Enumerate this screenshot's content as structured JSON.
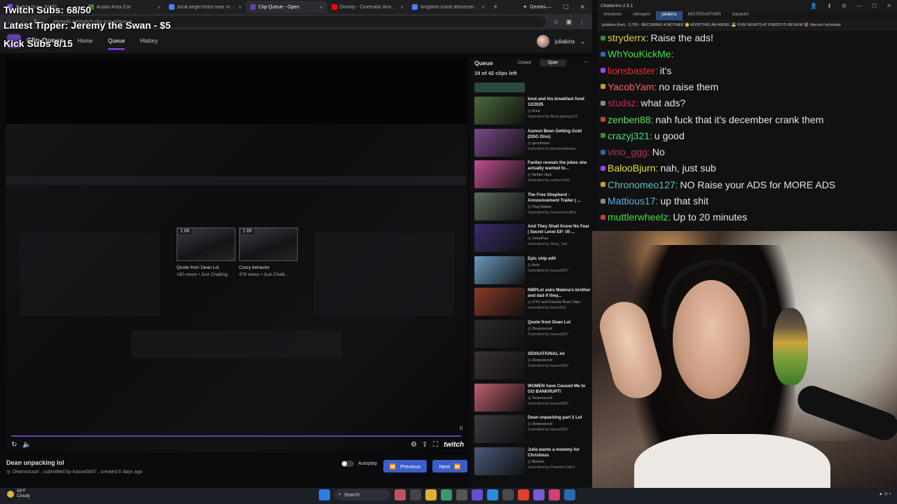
{
  "browser": {
    "tabs": [
      {
        "title": "Twitch Subs: 68/50",
        "color": "#9147ff"
      },
      {
        "title": "Austin Area Cor",
        "color": "#4a7a3a"
      },
      {
        "title": "local angel trees near me - Go",
        "color": "#4285f4"
      },
      {
        "title": "Clip Queue - Open",
        "color": "#6441a5",
        "active": true
      },
      {
        "title": "Divinity - Cinematic Announ",
        "color": "#ff0000"
      },
      {
        "title": "kingdom come deliverance",
        "color": "#4285f4"
      }
    ],
    "gemini_label": "Gemini",
    "url": "jakemiki.me/twitch-clip-queue/queue"
  },
  "site": {
    "title": "Clip Queue",
    "nav": [
      "Home",
      "Queue",
      "History"
    ],
    "active_nav": "Queue",
    "username": "juliakins"
  },
  "player": {
    "count": "0",
    "clips": [
      {
        "duration": "1:00",
        "title": "Quote from Dean Lol",
        "meta": "180 views • Just Chatting"
      },
      {
        "duration": "1:00",
        "title": "Crazy behavior",
        "meta": "478 views • Just Chatti..."
      }
    ]
  },
  "current": {
    "title": "Dean unpacking lol",
    "channel": "Deansocool",
    "submitted": ", submitted by kasun0007 , created 6 days ago",
    "autoplay_label": "Autoplay",
    "prev_label": "Previous",
    "next_label": "Next"
  },
  "queue": {
    "title": "Queue",
    "tabs": [
      "Closed",
      "Open"
    ],
    "active_tab": "Open",
    "count_text": "19 of 42 clips left",
    "items": [
      {
        "title": "knut and his breakfast food 12/2025",
        "source": "Knut",
        "by": "Submitted by BlueLightingZZZ",
        "color": "#4a6a3a"
      },
      {
        "title": "Asmon Been Getting Gold (DDG Diss)",
        "source": "guccimarx",
        "by": "Submitted by blackbirdsleeps",
        "color": "#7a4a8a"
      },
      {
        "title": "Fanfan reveals the jokes she actually wanted to...",
        "source": "fanfan clips",
        "by": "Submitted by nathan14x0",
        "color": "#c05090"
      },
      {
        "title": "The Free Shepherd - Announcement Trailer | ...",
        "source": "PlayStation",
        "by": "Submitted by GlazinDonutBoi",
        "color": "#5a6a5a"
      },
      {
        "title": "And They Shall Know No Fear | Secret Level EP: 05 ...",
        "source": "OrionPax",
        "by": "Submitted by Stray_Yak",
        "color": "#3a2a6a"
      },
      {
        "title": "Epic ship edit",
        "source": "Acie",
        "by": "Submitted by kasun0007",
        "color": "#6a9ac0"
      },
      {
        "title": "NMPLol asks Malena's brother and dad if they...",
        "source": "OTV and Friends Rust Clips",
        "by": "Submitted by Muho555",
        "color": "#8a3a2a"
      },
      {
        "title": "Quote from Dean Lol",
        "source": "Deansocool",
        "by": "Submitted by kasun0007",
        "color": "#2a2a2a"
      },
      {
        "title": "SENSATIONAL lol",
        "source": "Deansocool",
        "by": "Submitted by kasun0007",
        "color": "#3a3030"
      },
      {
        "title": "WOMEN have Caused Me to GO BANKRUPT!",
        "source": "Deansocool",
        "by": "Submitted by kasun0007",
        "color": "#c06070"
      },
      {
        "title": "Dean unpacking part 2 Lol",
        "source": "Deansocool",
        "by": "Submitted by kasun0007",
        "color": "#3a3a40"
      },
      {
        "title": "Julia wants a mommy for Christmas",
        "source": "Bonnie",
        "by": "Submitted by PeterMcCall14",
        "color": "#4a5a7a"
      }
    ]
  },
  "overlay": {
    "subs": "Twitch Subs: 68/50",
    "tipper": "Latest Tipper: Jeremy the Swan - $5",
    "kick": "Kick Subs 8/15"
  },
  "chat": {
    "app_title": "Chatterino 2.5.1",
    "tabs": [
      "/mentions",
      "/whispers",
      "juliakins",
      "MISTERARTHER",
      "itskatchii"
    ],
    "active_tab": "juliakins",
    "topic": "juliakins (live) - 3,700 - BECOMING A MOTHER 👶 ADOPTING AN ANGEL 👼 FIVE NIGHTS AT FREDDYS REVIEW 🐻 !discord !schedule",
    "messages": [
      {
        "user": "stryderrx:",
        "text": "Raise the ads!",
        "color": "#e0d040"
      },
      {
        "user": "WhYouKickMe:",
        "text": "",
        "color": "#40e040"
      },
      {
        "user": "lionsbaster:",
        "text": "it's",
        "color": "#e03030"
      },
      {
        "user": "YacobYam:",
        "text": "no raise them",
        "color": "#ff6060"
      },
      {
        "user": "studsz:",
        "text": "what ads?",
        "color": "#d02060"
      },
      {
        "user": "zenben88:",
        "text": "nah fuck that it's december crank them",
        "color": "#60e060"
      },
      {
        "user": "crazyj321:",
        "text": "u good",
        "color": "#40e080"
      },
      {
        "user": "vino_ggg:",
        "text": "No",
        "color": "#c03050"
      },
      {
        "user": "BalooBjurn:",
        "text": "nah, just sub",
        "color": "#e0e040"
      },
      {
        "user": "Chronomeo127:",
        "text": "NO Raise your ADS for MORE ADS",
        "color": "#60c0c0"
      },
      {
        "user": "Mattious17:",
        "text": "up that shit",
        "color": "#60b0e0"
      },
      {
        "user": "muttlerwheelz:",
        "text": "Up to 20 minutes",
        "color": "#40e040"
      }
    ]
  },
  "taskbar": {
    "temp": "58°F",
    "condition": "Cloudy",
    "search": "Search"
  }
}
